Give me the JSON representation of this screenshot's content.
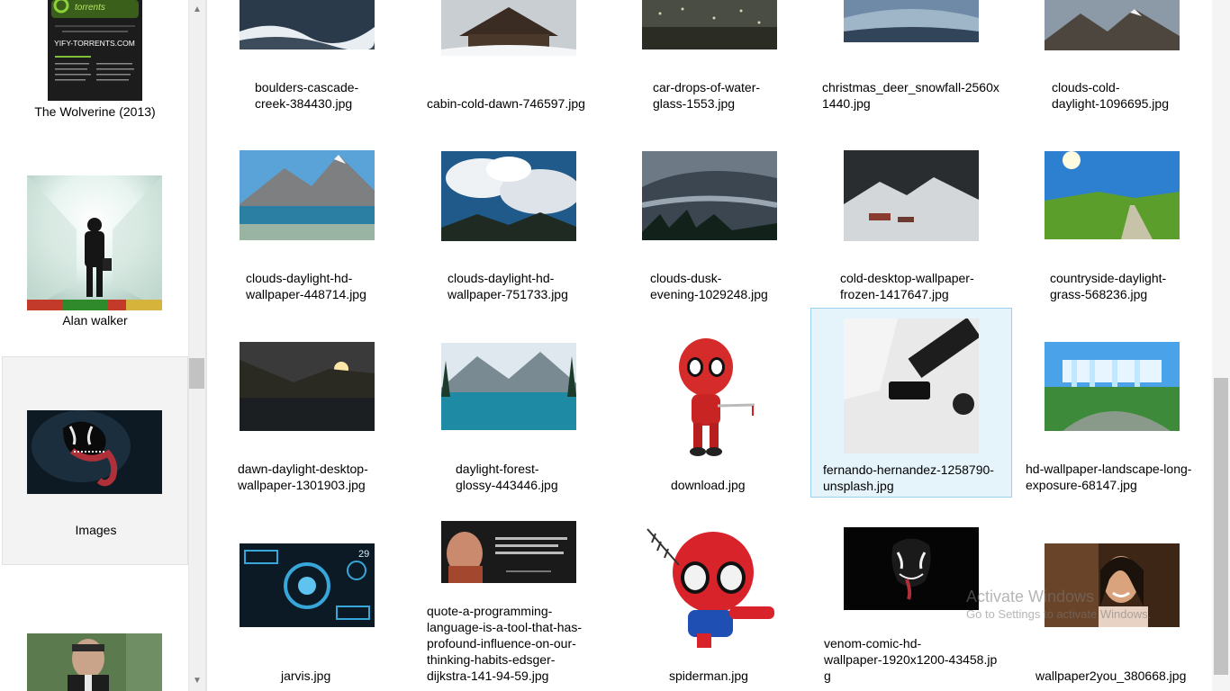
{
  "left_pane": {
    "folders": [
      {
        "label": "The Wolverine (2013)",
        "thumb_text": [
          "YIFY-TORRENTS.COM",
          "torrents"
        ]
      },
      {
        "label": "Alan walker"
      },
      {
        "label": "Images"
      },
      {
        "label": ""
      }
    ]
  },
  "grid": {
    "rows": [
      [
        "boulders-cascade-creek-384430.jpg",
        "cabin-cold-dawn-746597.jpg",
        "car-drops-of-water-glass-1553.jpg",
        "christmas_deer_snowfall-2560x1440.jpg",
        "clouds-cold-daylight-1096695.jpg"
      ],
      [
        "clouds-daylight-hd-wallpaper-448714.jpg",
        "clouds-daylight-hd-wallpaper-751733.jpg",
        "clouds-dusk-evening-1029248.jpg",
        "cold-desktop-wallpaper-frozen-1417647.jpg",
        "countryside-daylight-grass-568236.jpg"
      ],
      [
        "dawn-daylight-desktop-wallpaper-1301903.jpg",
        "daylight-forest-glossy-443446.jpg",
        "download.jpg",
        "fernando-hernandez-1258790-unsplash.jpg",
        "hd-wallpaper-landscape-long-exposure-68147.jpg"
      ],
      [
        "jarvis.jpg",
        "quote-a-programming-language-is-a-tool-that-has-profound-influence-on-our-thinking-habits-edsger-dijkstra-141-94-59.jpg",
        "spiderman.jpg",
        "venom-comic-hd-wallpaper-1920x1200-43458.jpg",
        "wallpaper2you_380668.jpg"
      ]
    ],
    "display_lines": [
      [
        [
          "boulders-cascade-",
          "creek-384430.jpg"
        ],
        [
          "cabin-cold-dawn-746597.jpg"
        ],
        [
          "car-drops-of-water-",
          "glass-1553.jpg"
        ],
        [
          "christmas_deer_snowfall-2560x",
          "1440.jpg"
        ],
        [
          "clouds-cold-",
          "daylight-1096695.jpg"
        ]
      ],
      [
        [
          "clouds-daylight-hd-",
          "wallpaper-448714.jpg"
        ],
        [
          "clouds-daylight-hd-",
          "wallpaper-751733.jpg"
        ],
        [
          "clouds-dusk-",
          "evening-1029248.jpg"
        ],
        [
          "cold-desktop-wallpaper-",
          "frozen-1417647.jpg"
        ],
        [
          "countryside-daylight-",
          "grass-568236.jpg"
        ]
      ],
      [
        [
          "dawn-daylight-desktop-",
          "wallpaper-1301903.jpg"
        ],
        [
          "daylight-forest-",
          "glossy-443446.jpg"
        ],
        [
          "download.jpg"
        ],
        [
          "fernando-hernandez-1258790-",
          "unsplash.jpg"
        ],
        [
          "hd-wallpaper-landscape-long-",
          "exposure-68147.jpg"
        ]
      ],
      [
        [
          "jarvis.jpg"
        ],
        [
          "quote-a-programming-",
          "language-is-a-tool-that-has-",
          "profound-influence-on-our-",
          "thinking-habits-edsger-",
          "dijkstra-141-94-59.jpg"
        ],
        [
          "spiderman.jpg"
        ],
        [
          "venom-comic-hd-",
          "wallpaper-1920x1200-43458.jp",
          "g"
        ],
        [
          "wallpaper2you_380668.jpg"
        ]
      ]
    ],
    "selected": "fernando-hernandez-1258790-unsplash.jpg"
  },
  "quote_thumb_text": "A programming language is a tool that has profound influence on our thinking habits.",
  "jarvis_thumb_text": "29",
  "watermark": {
    "title": "Activate Windows",
    "subtitle": "Go to Settings to activate Windows."
  },
  "colors": {
    "selection_bg": "#e5f3fb",
    "selection_border": "#99d1ef",
    "folder_selected_bg": "#f3f3f3"
  },
  "icons": [
    "scroll-up-arrow-icon",
    "scroll-down-arrow-icon"
  ]
}
